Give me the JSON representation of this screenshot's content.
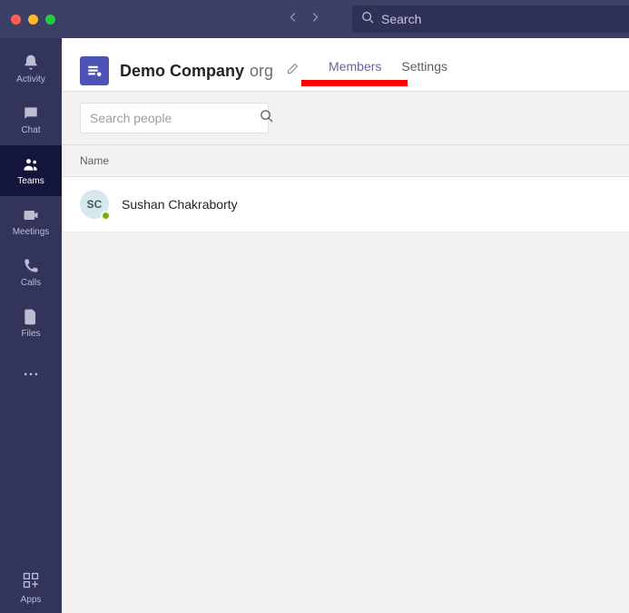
{
  "searchPlaceholder": "Search",
  "rail": {
    "activity": "Activity",
    "chat": "Chat",
    "teams": "Teams",
    "meetings": "Meetings",
    "calls": "Calls",
    "files": "Files",
    "apps": "Apps"
  },
  "org": {
    "nameStrong": "Demo Company",
    "nameLight": "org"
  },
  "tabs": {
    "members": "Members",
    "settings": "Settings"
  },
  "peopleSearchPlaceholder": "Search people",
  "columns": {
    "name": "Name"
  },
  "members": [
    {
      "initials": "SC",
      "name": "Sushan Chakraborty"
    }
  ]
}
